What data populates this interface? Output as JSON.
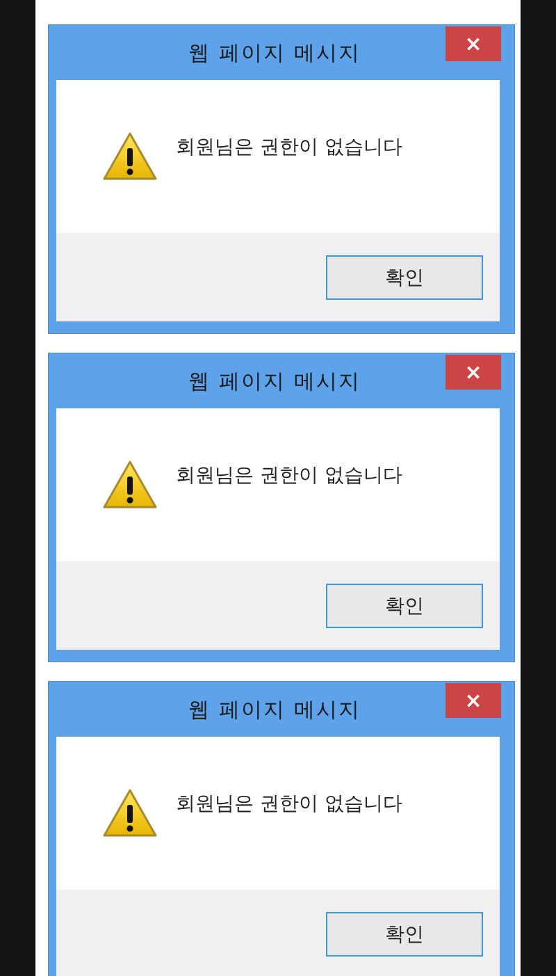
{
  "dialogs": [
    {
      "title": "웹 페이지 메시지",
      "close": "×",
      "message": "회원님은 권한이 없습니다",
      "button": "확인"
    },
    {
      "title": "웹 페이지 메시지",
      "close": "×",
      "message": "회원님은 권한이 없습니다",
      "button": "확인"
    },
    {
      "title": "웹 페이지 메시지",
      "close": "×",
      "message": "회원님은 권한이 없습니다",
      "button": "확인"
    }
  ]
}
